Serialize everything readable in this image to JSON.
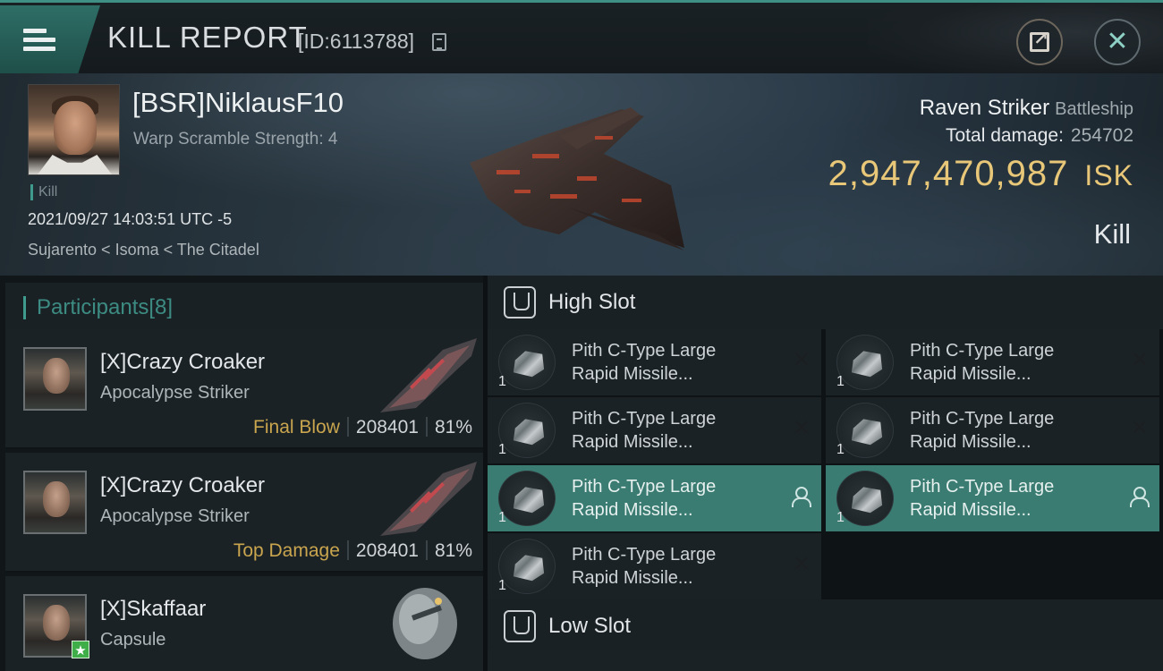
{
  "header": {
    "title": "KILL REPORT",
    "report_id": "[ID:6113788]"
  },
  "victim": {
    "name": "[BSR]NiklausF10",
    "warp_scramble": "Warp Scramble Strength: 4",
    "kill_tag": "Kill",
    "datetime": "2021/09/27 14:03:51 UTC -5",
    "location": "Sujarento < Isoma < The Citadel",
    "ship_name": "Raven Striker",
    "ship_class": "Battleship",
    "total_damage_label": "Total damage:",
    "total_damage": "254702",
    "isk_value": "2,947,470,987",
    "isk_unit": "ISK",
    "result": "Kill"
  },
  "participants": {
    "label": "Participants",
    "count": "[8]",
    "list": [
      {
        "name": "[X]Crazy Croaker",
        "ship": "Apocalypse Striker",
        "tag": "Final Blow",
        "damage": "208401",
        "percent": "81%"
      },
      {
        "name": "[X]Crazy Croaker",
        "ship": "Apocalypse Striker",
        "tag": "Top Damage",
        "damage": "208401",
        "percent": "81%"
      },
      {
        "name": "[X]Skaffaar",
        "ship": "Capsule"
      }
    ]
  },
  "fitting": {
    "high_slot_label": "High Slot",
    "low_slot_label": "Low Slot",
    "high_modules": [
      {
        "line1": "Pith C-Type Large",
        "line2": "Rapid Missile...",
        "qty": "1",
        "state": "destroyed"
      },
      {
        "line1": "Pith C-Type Large",
        "line2": "Rapid Missile...",
        "qty": "1",
        "state": "destroyed"
      },
      {
        "line1": "Pith C-Type Large",
        "line2": "Rapid Missile...",
        "qty": "1",
        "state": "destroyed"
      },
      {
        "line1": "Pith C-Type Large",
        "line2": "Rapid Missile...",
        "qty": "1",
        "state": "destroyed"
      },
      {
        "line1": "Pith C-Type Large",
        "line2": "Rapid Missile...",
        "qty": "1",
        "state": "dropped"
      },
      {
        "line1": "Pith C-Type Large",
        "line2": "Rapid Missile...",
        "qty": "1",
        "state": "dropped"
      },
      {
        "line1": "Pith C-Type Large",
        "line2": "Rapid Missile...",
        "qty": "1",
        "state": "destroyed"
      }
    ]
  },
  "icons": {
    "menu": "hamburger-menu-icon",
    "copy": "copy-icon",
    "share": "share-icon",
    "close": "close-icon",
    "slot": "slot-icon",
    "destroyed": "destroyed-x-icon",
    "dropped": "person-icon"
  },
  "colors": {
    "accent": "#3e9b8e",
    "isk": "#e8c778",
    "final_blow": "#c9a54e",
    "selected_module": "#3a7b72"
  }
}
